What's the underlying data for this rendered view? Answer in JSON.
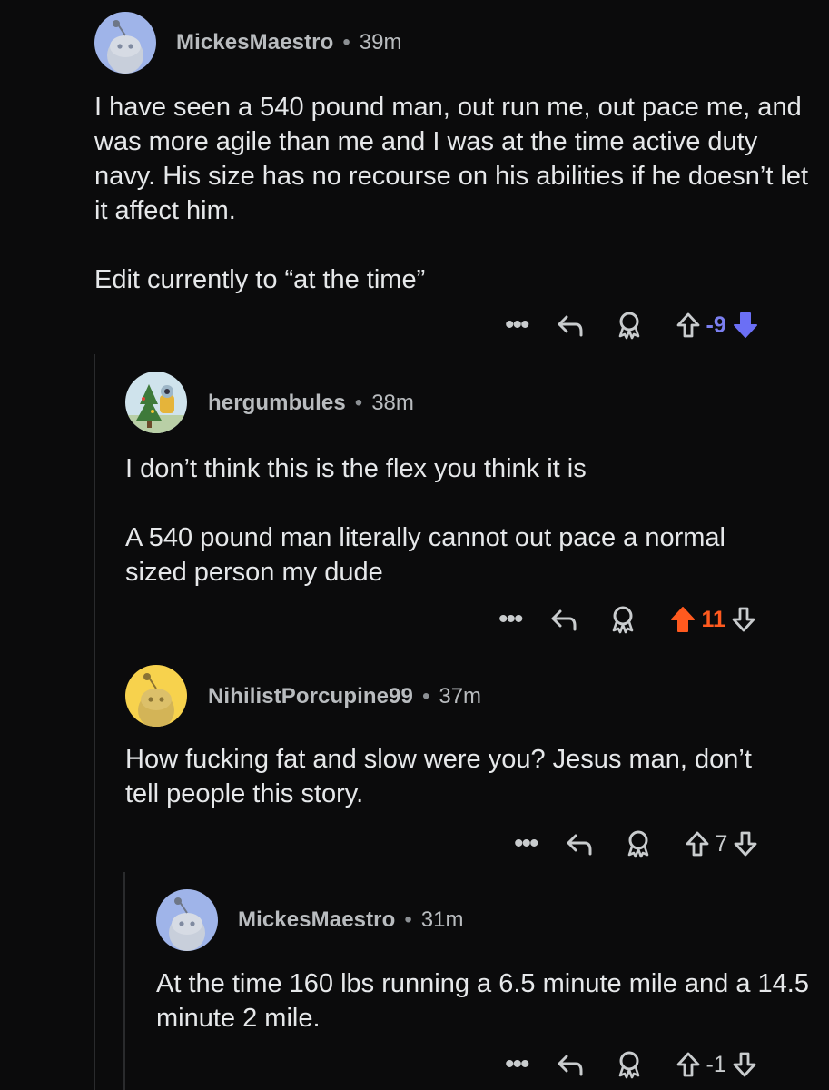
{
  "comments": [
    {
      "author": "MickesMaestro",
      "age": "39m",
      "avatar": "snoo-avatar-blue",
      "paragraphs": [
        "I have seen a 540 pound man, out run me, out pace me, and was more agile than me and I was at the time active duty navy. His size has no recourse on his abilities if he doesn’t let it affect him.",
        "Edit currently to “at the time”"
      ],
      "score": "-9",
      "vote_state": "downvoted",
      "score_color": "#7b7ff0"
    },
    {
      "author": "hergumbules",
      "age": "38m",
      "avatar": "custom-avatar-tree",
      "paragraphs": [
        "I don’t think this is the flex you think it is",
        "A 540 pound man literally cannot out pace a normal sized person my dude"
      ],
      "score": "11",
      "vote_state": "upvoted",
      "score_color": "#ff5a1f"
    },
    {
      "author": "NihilistPorcupine99",
      "age": "37m",
      "avatar": "snoo-avatar-yellow",
      "paragraphs": [
        "How fucking fat and slow were you? Jesus man, don’t tell people this story."
      ],
      "score": "7",
      "vote_state": "none",
      "score_color": "#c9ccce"
    },
    {
      "author": "MickesMaestro",
      "age": "31m",
      "avatar": "snoo-avatar-blue",
      "paragraphs": [
        "At the time 160 lbs running a 6.5 minute mile and a 14.5 minute 2 mile."
      ],
      "score": "-1",
      "vote_state": "none",
      "score_color": "#c9ccce"
    }
  ],
  "actions": {
    "more_label": "•••",
    "separator": "•"
  }
}
